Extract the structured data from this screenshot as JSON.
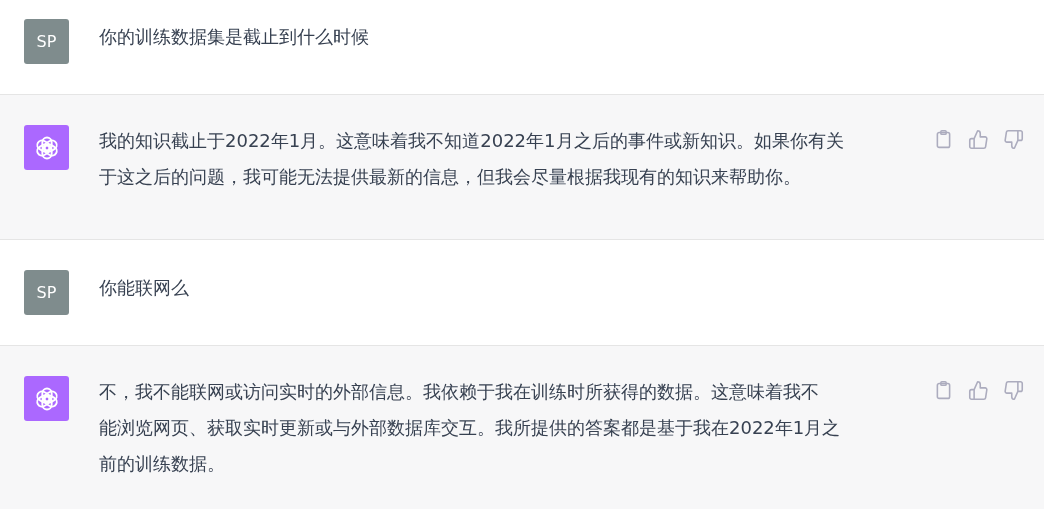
{
  "messages": [
    {
      "kind": "user",
      "avatar": "SP",
      "lines": [
        "你的训练数据集是截止到什么时候"
      ]
    },
    {
      "kind": "assistant",
      "lines": [
        "我的知识截止于2022年1月。这意味着我不知道2022年1月之后的事件或新知识。如果你有关",
        "于这之后的问题，我可能无法提供最新的信息，但我会尽量根据我现有的知识来帮助你。"
      ]
    },
    {
      "kind": "user",
      "avatar": "SP",
      "lines": [
        "你能联网么"
      ]
    },
    {
      "kind": "assistant",
      "lines": [
        "不，我不能联网或访问实时的外部信息。我依赖于我在训练时所获得的数据。这意味着我不",
        "能浏览网页、获取实时更新或与外部数据库交互。我所提供的答案都是基于我在2022年1月之",
        "前的训练数据。"
      ]
    }
  ]
}
